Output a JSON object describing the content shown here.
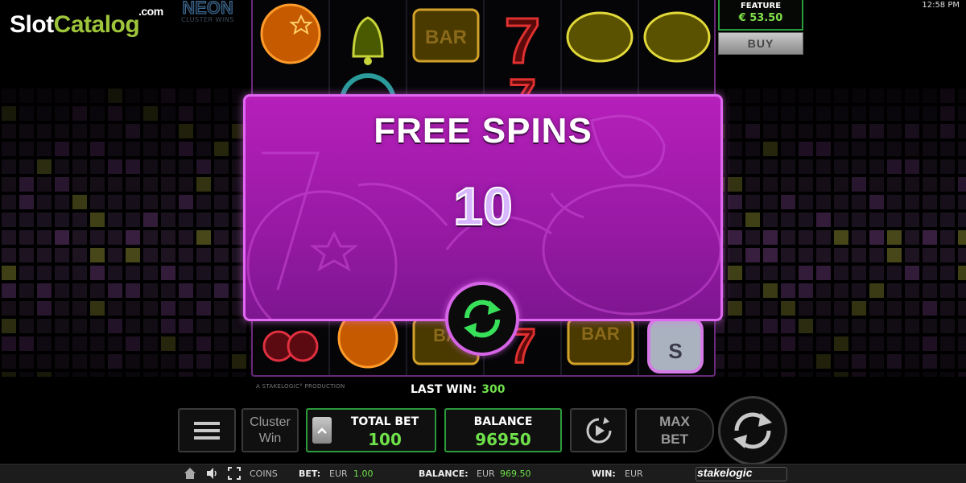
{
  "site_logo": {
    "part1": "Slot",
    "part2": "Catalog",
    "suffix": ".com"
  },
  "game_logo": {
    "title": "NEON",
    "subtitle": "CLUSTER WINS"
  },
  "clock": "12:58 PM",
  "feature": {
    "label": "FEATURE",
    "price": "€ 53.50",
    "buy_label": "BUY"
  },
  "production_note": "A STAKELOGIC° PRODUCTION",
  "free_spins": {
    "title": "FREE SPINS",
    "count": "10",
    "continue_icon": "refresh-arrows-icon"
  },
  "last_win": {
    "label": "LAST WIN:",
    "value": "300"
  },
  "controls": {
    "menu_icon": "hamburger-icon",
    "cluster_line1": "Cluster",
    "cluster_line2": "Win",
    "total_bet_label": "TOTAL BET",
    "total_bet_value": "100",
    "balance_label": "BALANCE",
    "balance_value": "96950",
    "autoplay_icon": "autoplay-icon",
    "max_bet_line1": "MAX",
    "max_bet_line2": "BET",
    "spin_icon": "spin-arrows-icon"
  },
  "status_bar": {
    "home_icon": "home-icon",
    "sound_icon": "speaker-icon",
    "fullscreen_icon": "fullscreen-icon",
    "coins_label": "COINS",
    "bet_label": "BET:",
    "bet_currency": "EUR",
    "bet_value": "1.00",
    "balance_label": "BALANCE:",
    "balance_currency": "EUR",
    "balance_value": "969.50",
    "win_label": "WIN:",
    "win_currency": "EUR",
    "provider": "stakelogic"
  },
  "colors": {
    "accent_green": "#6fe04a",
    "dialog_magenta": "#b61fba",
    "dialog_border": "#e068f0",
    "frame_green": "#2a9a3a"
  }
}
